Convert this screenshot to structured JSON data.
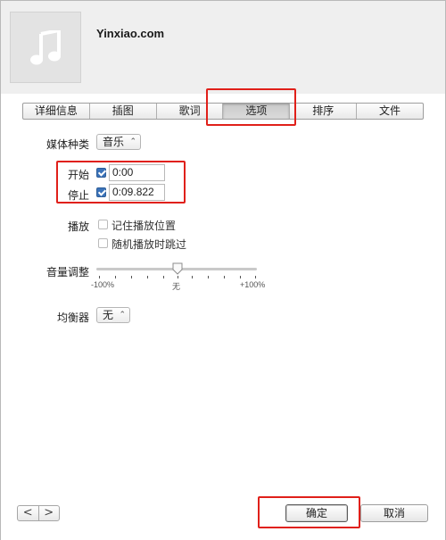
{
  "header": {
    "song_title": "Yinxiao.com",
    "artwork_icon": "music-note-icon"
  },
  "tabs": [
    {
      "label": "详细信息",
      "active": false
    },
    {
      "label": "插图",
      "active": false
    },
    {
      "label": "歌词",
      "active": false
    },
    {
      "label": "选项",
      "active": true
    },
    {
      "label": "排序",
      "active": false
    },
    {
      "label": "文件",
      "active": false
    }
  ],
  "options": {
    "media_kind_label": "媒体种类",
    "media_kind_value": "音乐",
    "start_label": "开始",
    "start_checked": true,
    "start_value": "0:00",
    "stop_label": "停止",
    "stop_checked": true,
    "stop_value": "0:09.822",
    "playback_label": "播放",
    "remember_position_label": "记住播放位置",
    "remember_position_checked": false,
    "skip_shuffle_label": "随机播放时跳过",
    "skip_shuffle_checked": false,
    "volume_label": "音量调整",
    "volume_min": "-100%",
    "volume_mid": "无",
    "volume_max": "+100%",
    "volume_level": 0,
    "equalizer_label": "均衡器",
    "equalizer_value": "无"
  },
  "footer": {
    "prev_label": "<",
    "next_label": ">",
    "ok_label": "确定",
    "cancel_label": "取消"
  },
  "highlight_color": "#e0201a"
}
